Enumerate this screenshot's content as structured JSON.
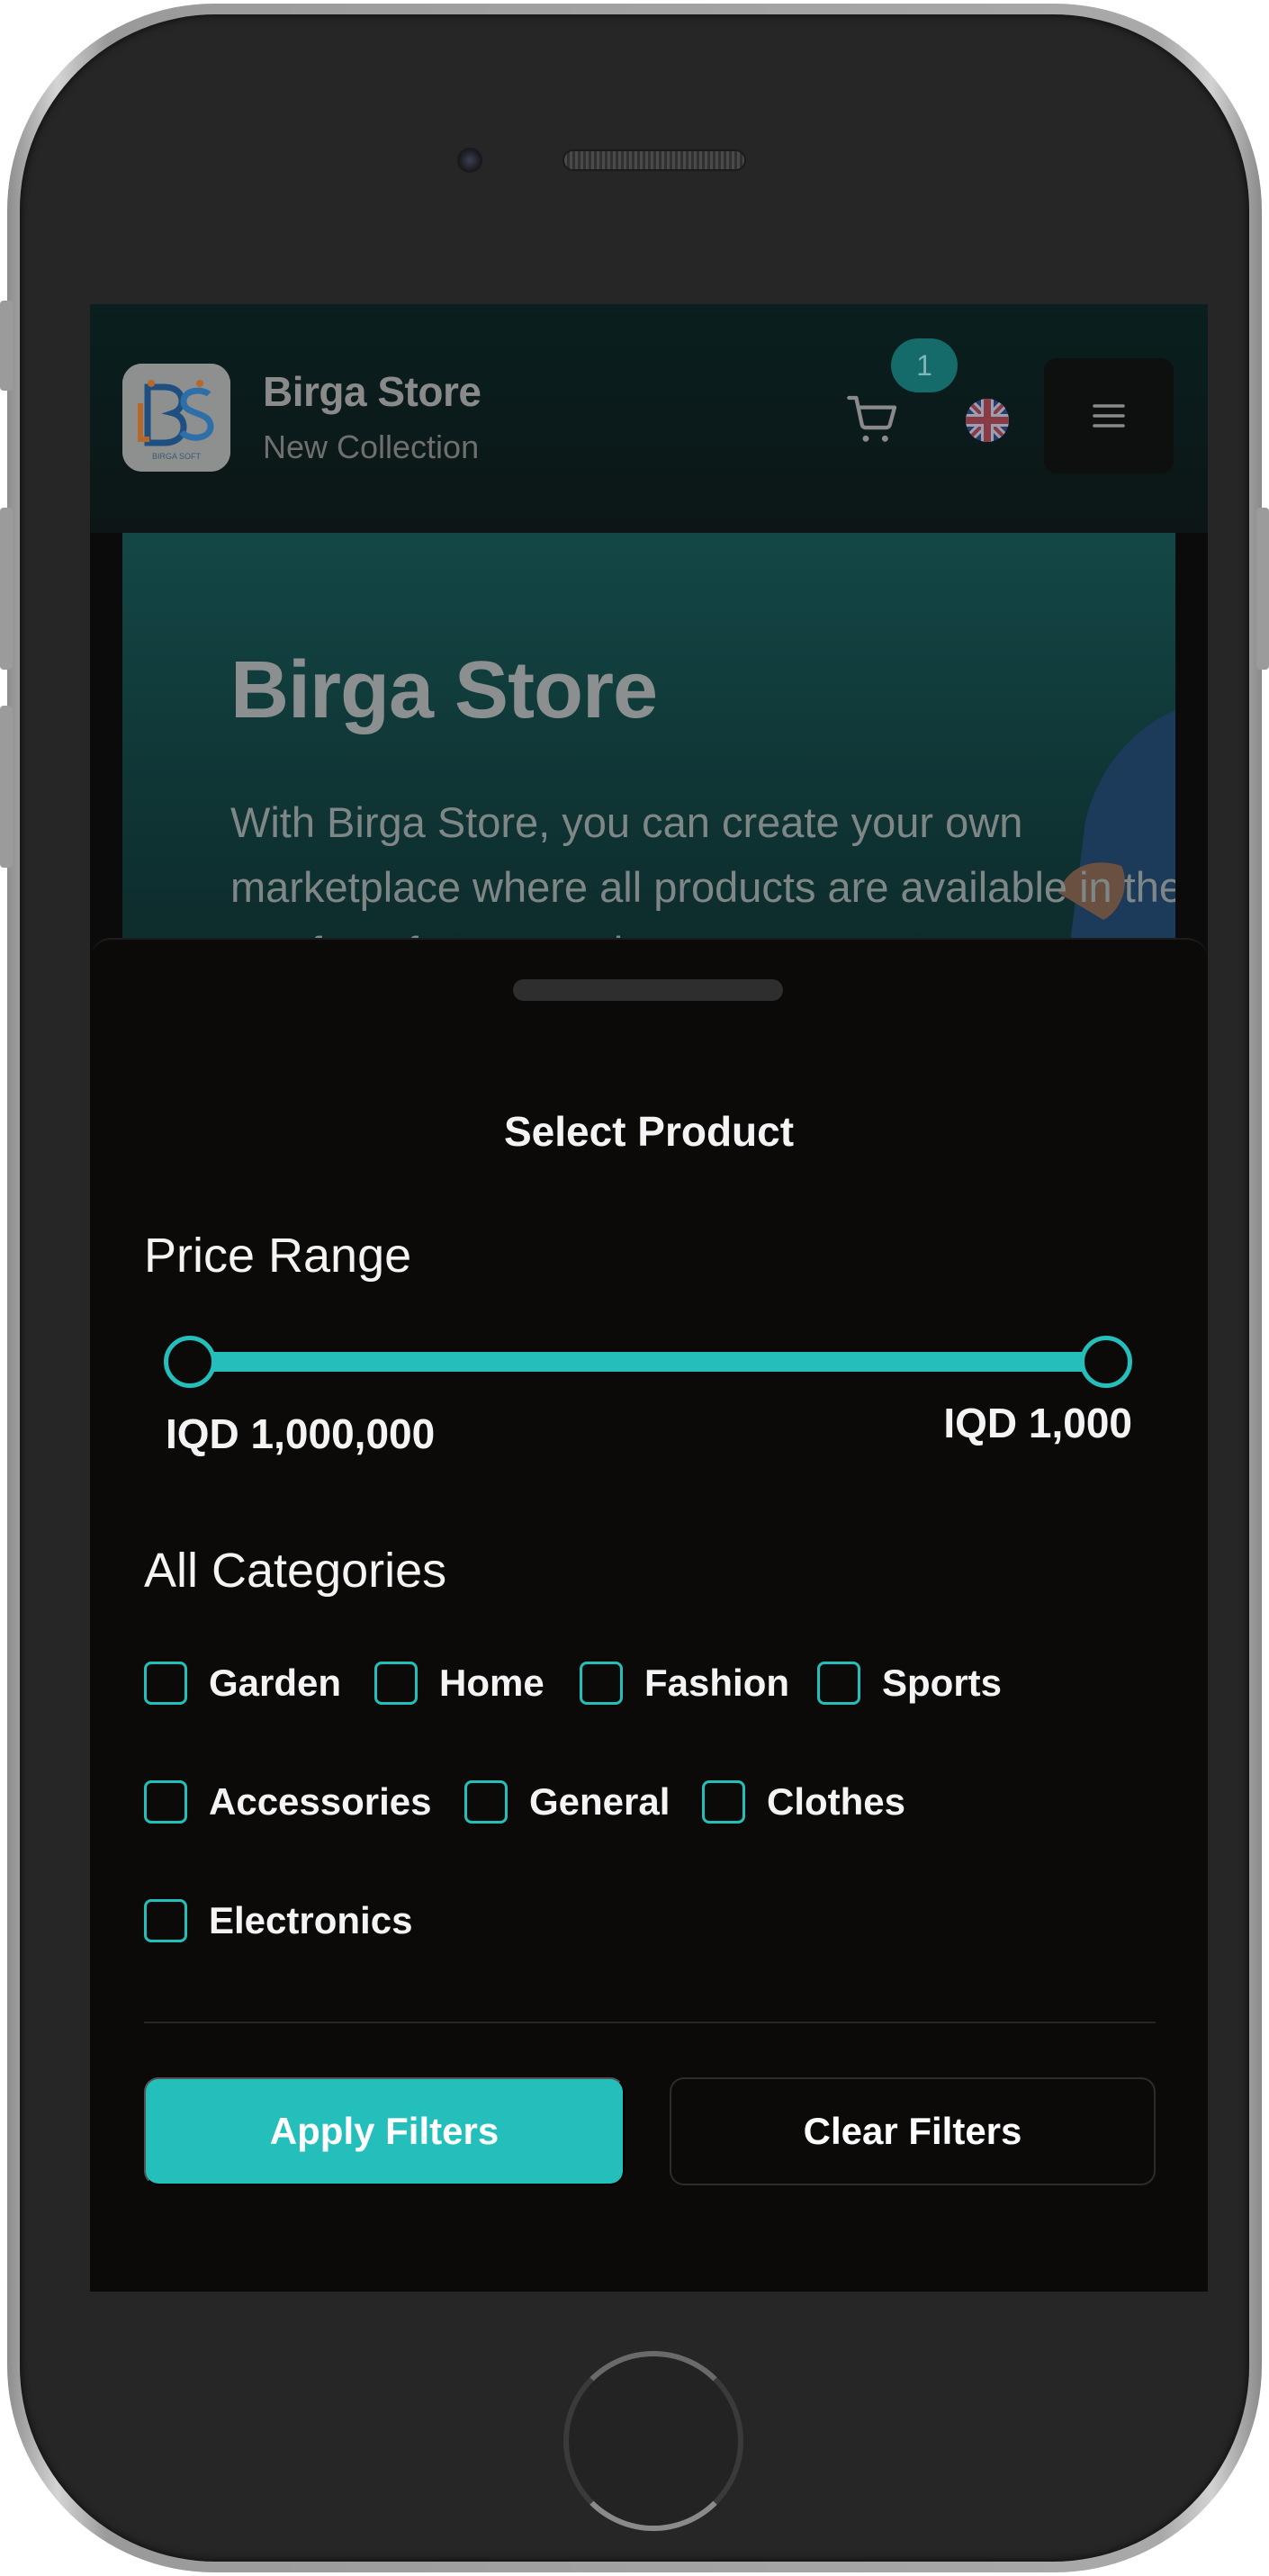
{
  "header": {
    "store_name": "Birga Store",
    "store_subtitle": "New Collection",
    "cart_count": "1",
    "logo_text": "BIRGA SOFT"
  },
  "hero": {
    "title": "Birga Store",
    "text": "With Birga Store, you can create your own marketplace where all products are available in the comfort of your own home"
  },
  "filter_sheet": {
    "title": "Select Product",
    "price_range": {
      "title": "Price Range",
      "min_label": "IQD 1,000,000",
      "max_label": "IQD 1,000",
      "fill_percent": 100
    },
    "categories": {
      "title": "All Categories",
      "items": [
        {
          "label": "Garden",
          "checked": false
        },
        {
          "label": "Home",
          "checked": false
        },
        {
          "label": "Fashion",
          "checked": false
        },
        {
          "label": "Sports",
          "checked": false
        },
        {
          "label": "Accessories",
          "checked": false
        },
        {
          "label": "General",
          "checked": false
        },
        {
          "label": "Clothes",
          "checked": false
        },
        {
          "label": "Electronics",
          "checked": false
        }
      ]
    },
    "apply_label": "Apply Filters",
    "clear_label": "Clear Filters"
  },
  "colors": {
    "accent": "#25bfbb",
    "sheet_background": "#0b0a09",
    "badge": "#156a6a"
  },
  "icons": {
    "cart": "cart-icon",
    "language": "uk-flag-icon",
    "menu": "hamburger-menu-icon"
  }
}
